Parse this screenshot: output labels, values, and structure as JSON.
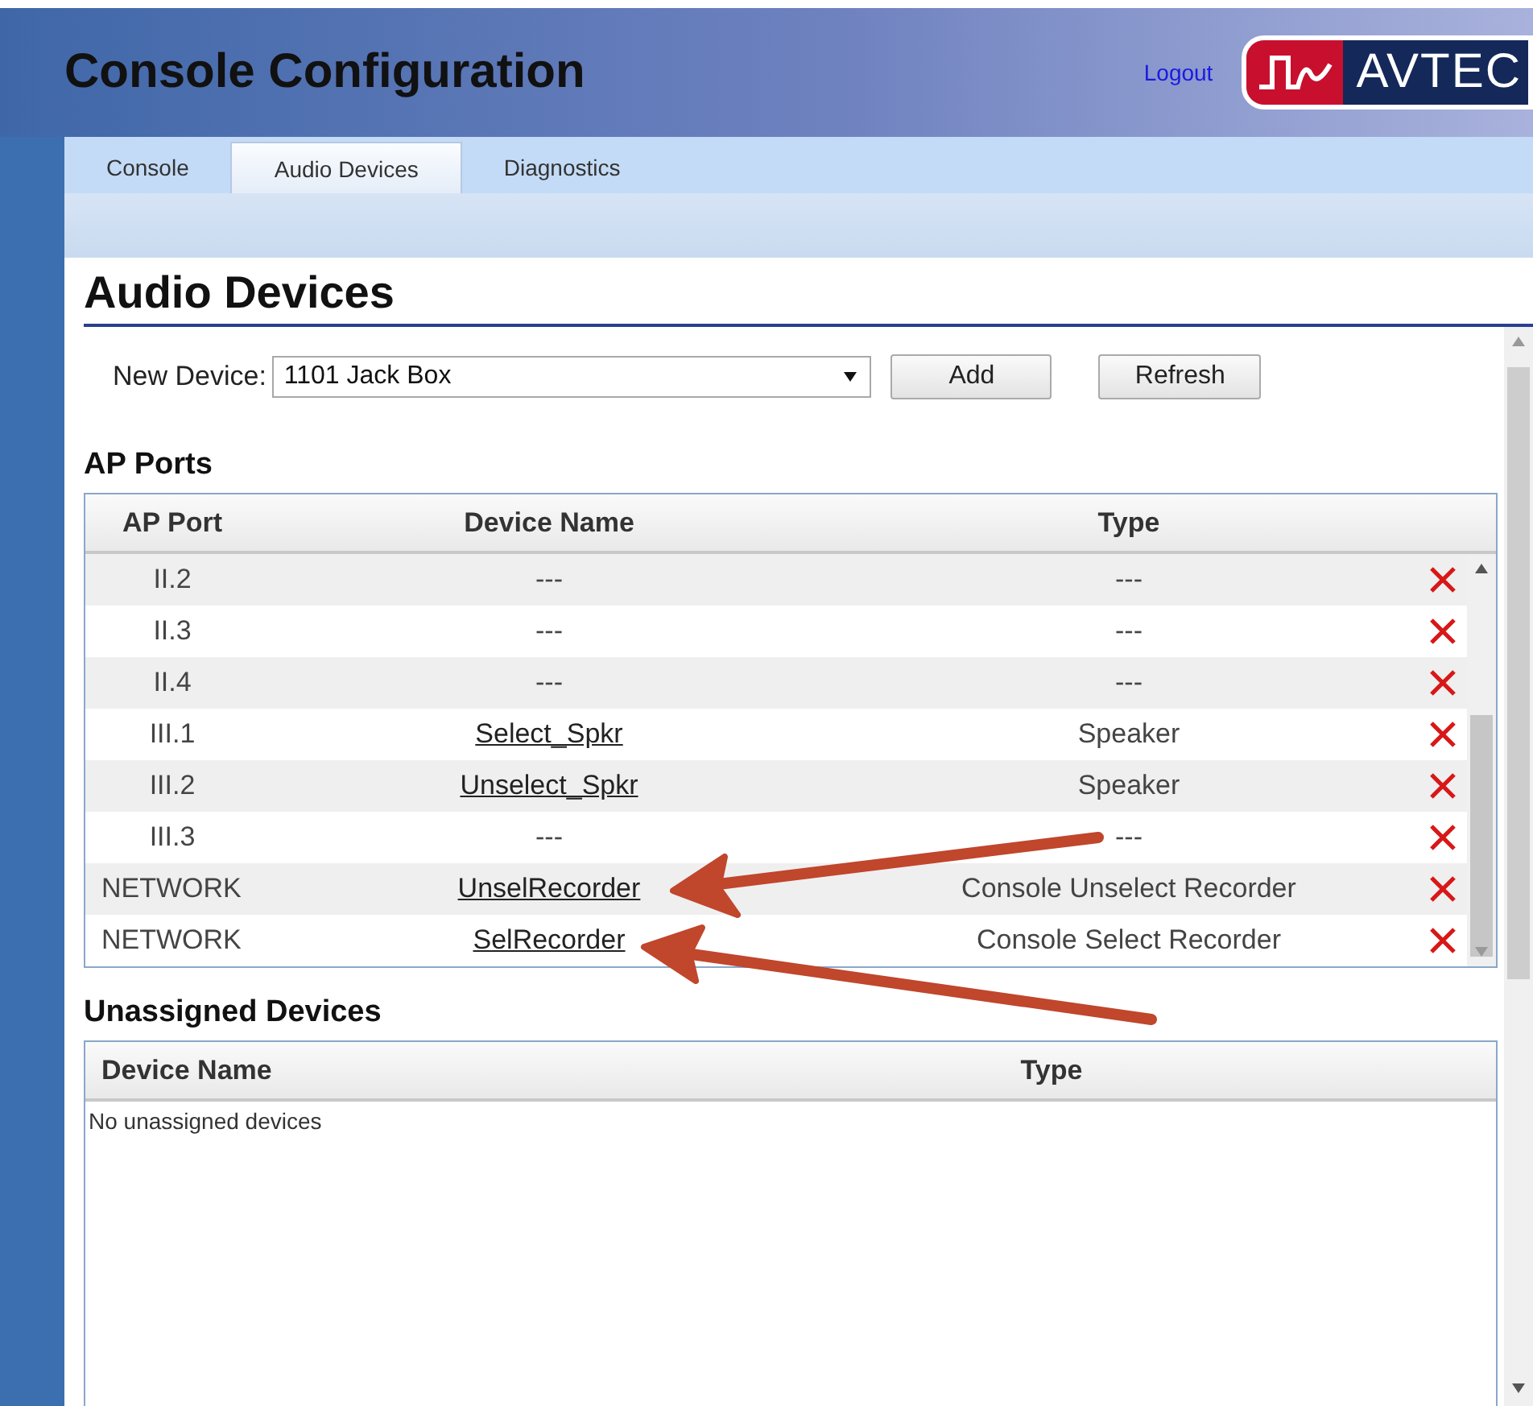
{
  "header": {
    "title": "Console Configuration",
    "logout": "Logout",
    "logo_text": "AVTEC"
  },
  "tabs": [
    {
      "label": "Console",
      "selected": false
    },
    {
      "label": "Audio Devices",
      "selected": true
    },
    {
      "label": "Diagnostics",
      "selected": false
    }
  ],
  "page_heading": "Audio Devices",
  "new_device": {
    "label": "New Device:",
    "value": "1101 Jack Box"
  },
  "buttons": [
    "Add",
    "Refresh"
  ],
  "ap_ports": {
    "title": "AP Ports",
    "columns": [
      "AP Port",
      "Device Name",
      "Type"
    ],
    "rows": [
      {
        "port": "II.2",
        "device": "---",
        "linked": false,
        "type": "---"
      },
      {
        "port": "II.3",
        "device": "---",
        "linked": false,
        "type": "---"
      },
      {
        "port": "II.4",
        "device": "---",
        "linked": false,
        "type": "---"
      },
      {
        "port": "III.1",
        "device": "Select_Spkr",
        "linked": true,
        "type": "Speaker"
      },
      {
        "port": "III.2",
        "device": "Unselect_Spkr",
        "linked": true,
        "type": "Speaker"
      },
      {
        "port": "III.3",
        "device": "---",
        "linked": false,
        "type": "---"
      },
      {
        "port": "NETWORK",
        "device": "UnselRecorder",
        "linked": true,
        "type": "Console Unselect Recorder"
      },
      {
        "port": "NETWORK",
        "device": "SelRecorder",
        "linked": true,
        "type": "Console Select Recorder"
      }
    ]
  },
  "unassigned": {
    "title": "Unassigned Devices",
    "columns": [
      "Device Name",
      "Type"
    ],
    "empty_text": "No unassigned devices"
  }
}
